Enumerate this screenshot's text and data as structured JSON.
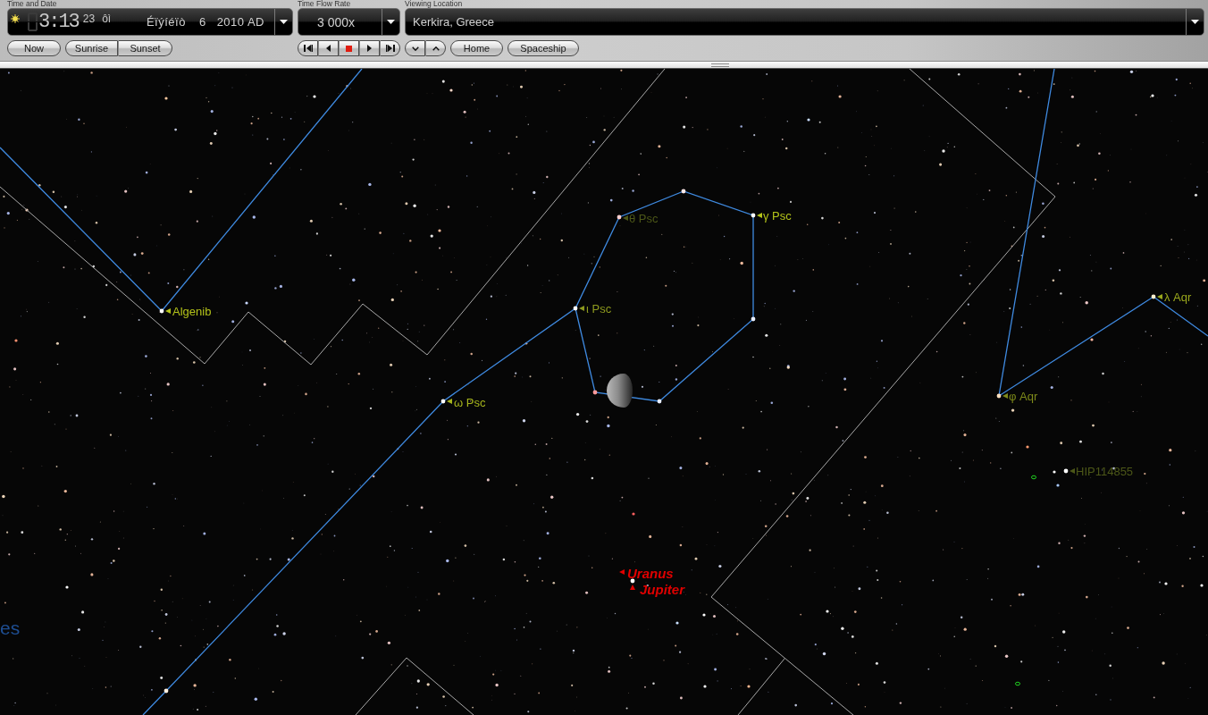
{
  "time_and_date": {
    "label": "Time and Date",
    "clock": "3:13",
    "seconds": "23",
    "period": "ôì",
    "month": "Éïýíéïò",
    "day": "6",
    "year": "2010 AD",
    "now_button": "Now",
    "sun_buttons": [
      "Sunrise",
      "Sunset"
    ]
  },
  "time_flow_rate": {
    "label": "Time Flow Rate",
    "value": "3 000x"
  },
  "viewing_location": {
    "label": "Viewing Location",
    "value": "Kerkira, Greece",
    "buttons": [
      "Home",
      "Spaceship"
    ]
  },
  "sky": {
    "labels": [
      {
        "text": "θ Psc",
        "kind": "star",
        "color": "#4c5718"
      },
      {
        "text": "γ Psc",
        "kind": "star",
        "color": "#b4c31a"
      },
      {
        "text": "Algenib",
        "kind": "star",
        "color": "#b4c31a"
      },
      {
        "text": "ι Psc",
        "kind": "star",
        "color": "#8e9a1e"
      },
      {
        "text": "λ Aqr",
        "kind": "star",
        "color": "#9aa81c"
      },
      {
        "text": "ω Psc",
        "kind": "star",
        "color": "#a6b41c"
      },
      {
        "text": "φ Aqr",
        "kind": "star",
        "color": "#7e8a1a"
      },
      {
        "text": "HIP114855",
        "kind": "star",
        "color": "#4c5718"
      },
      {
        "text": "Uranus",
        "kind": "planet",
        "color": "#e00000"
      },
      {
        "text": "Jupiter",
        "kind": "planet",
        "color": "#e00000"
      }
    ],
    "constellation_name": "es"
  }
}
